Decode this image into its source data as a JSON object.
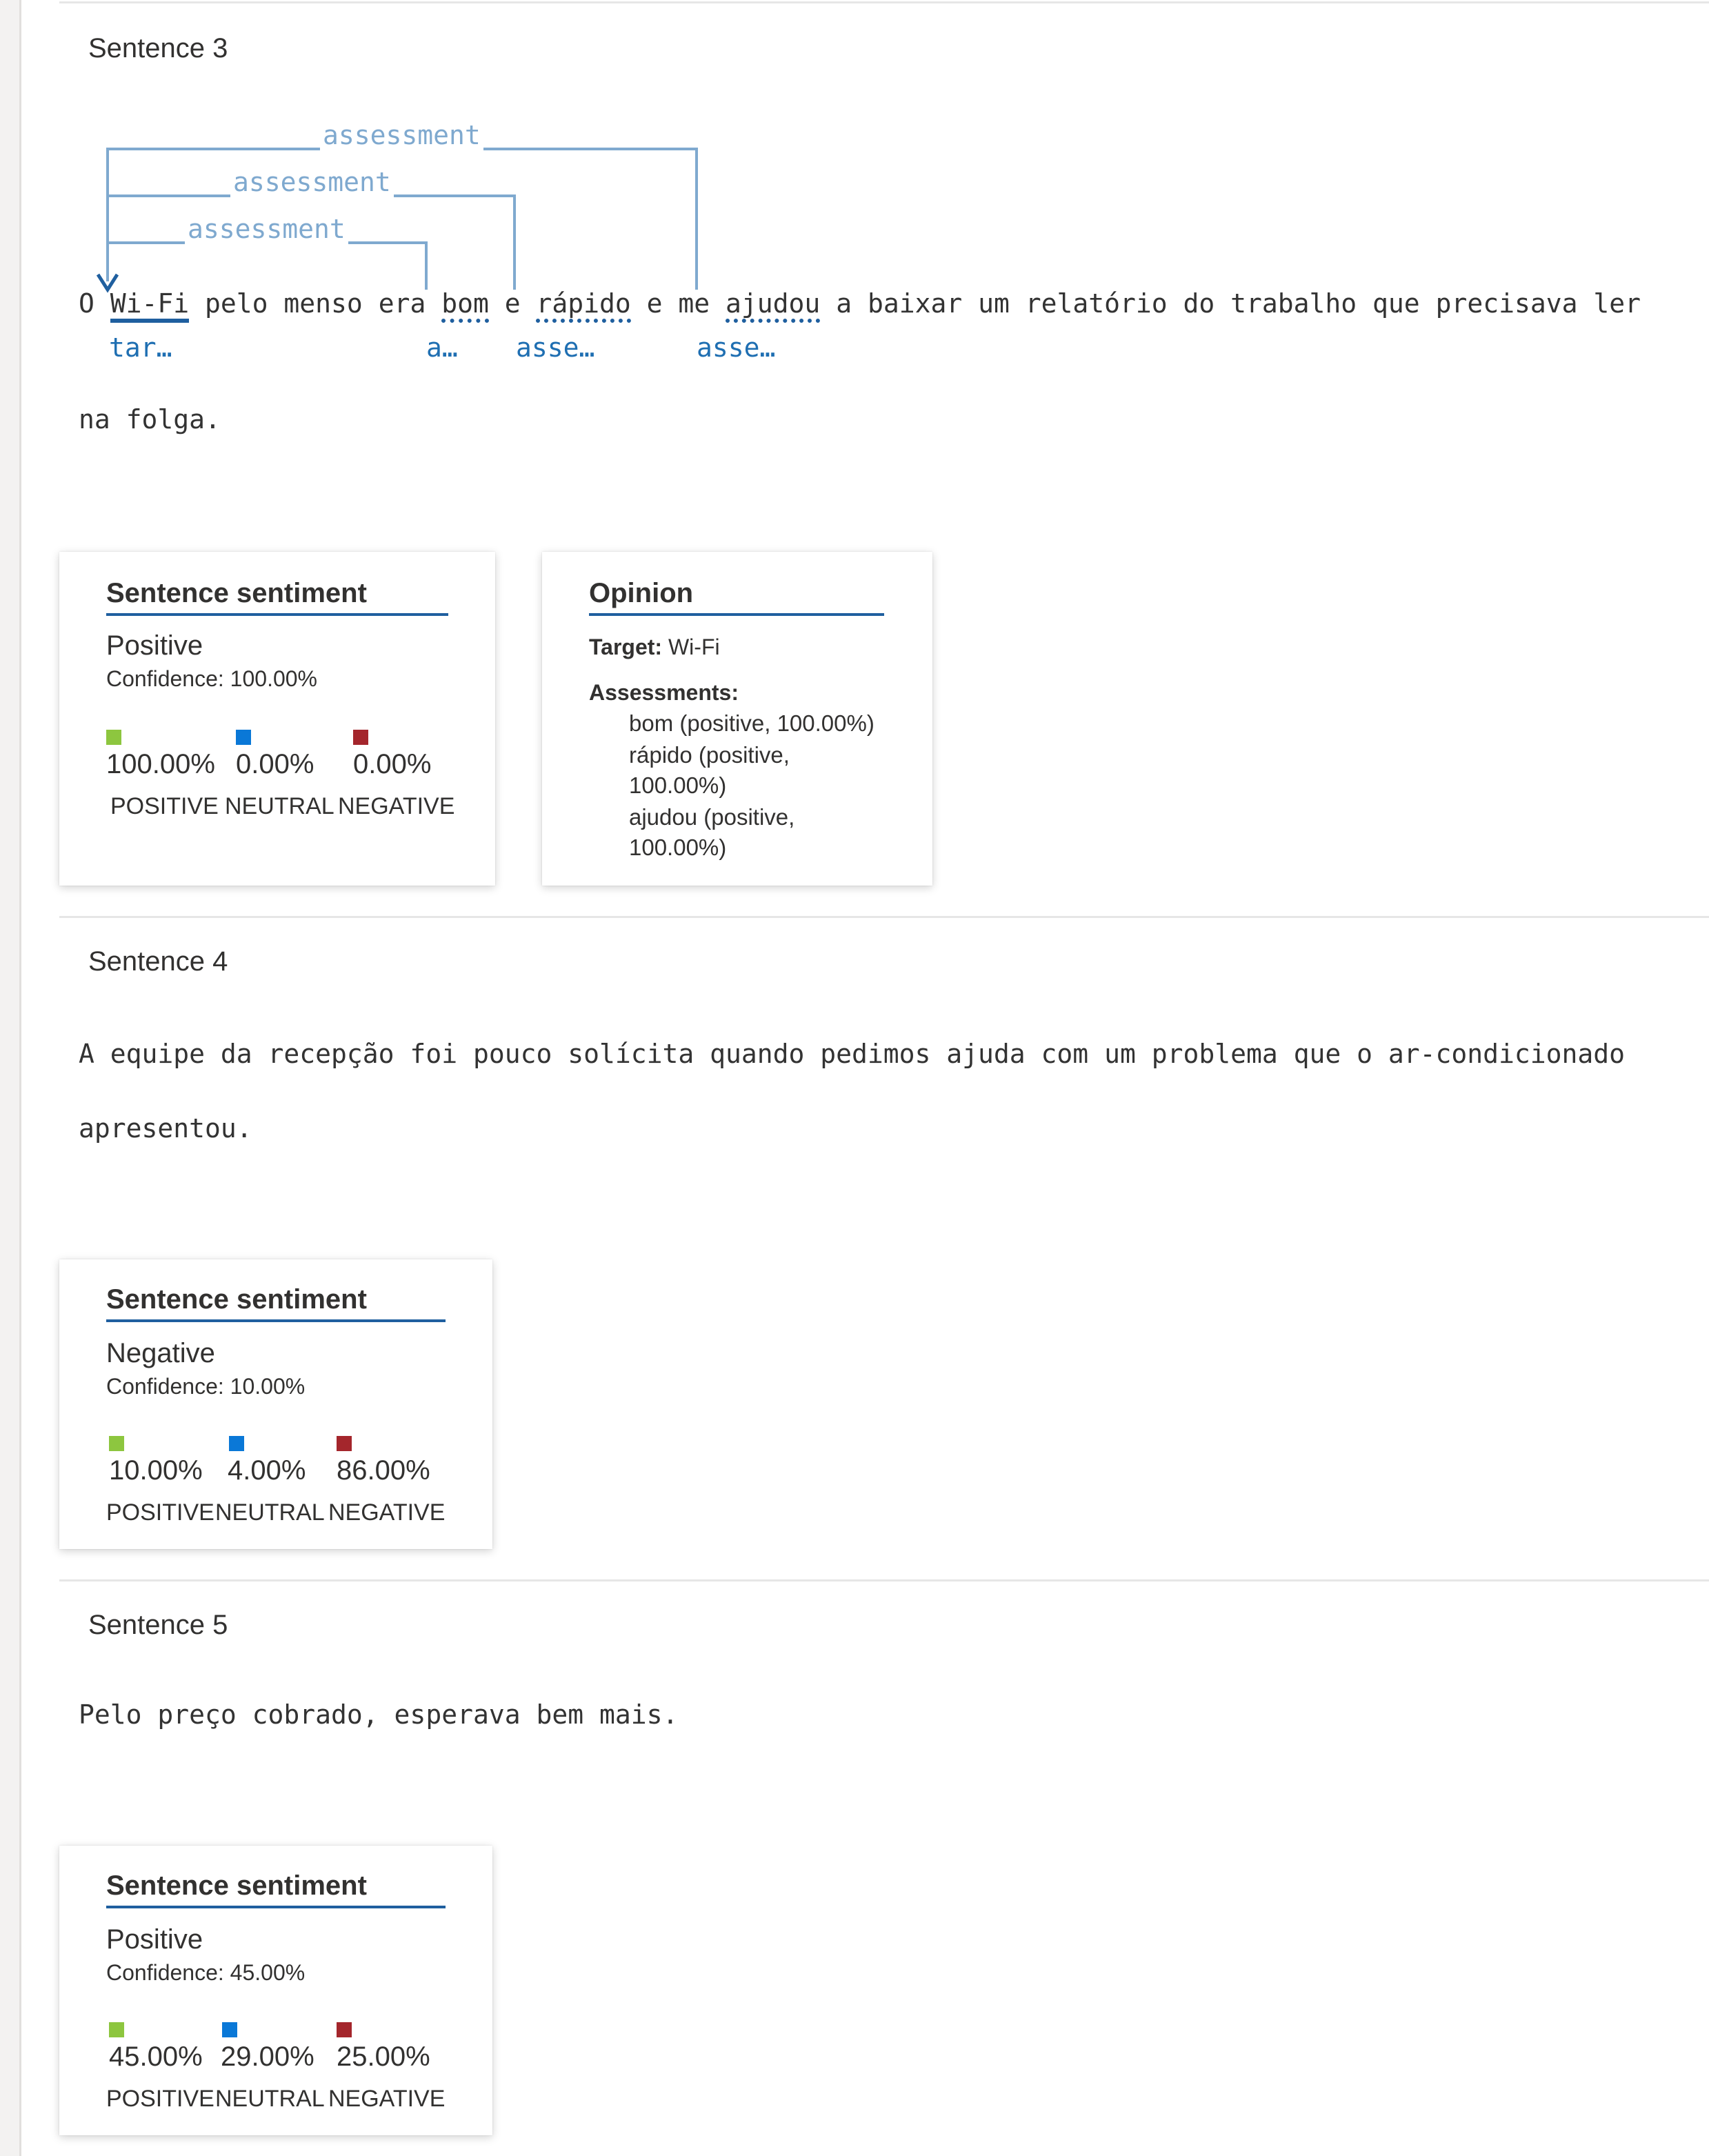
{
  "colors": {
    "positive": "#8dc63f",
    "neutral": "#0a78d7",
    "negative": "#a4262c",
    "accent": "#1f5f9f",
    "relation": "#7fa9cf"
  },
  "sentence3": {
    "title": "Sentence 3",
    "line1_tokens": [
      "O ",
      "Wi-Fi",
      " pelo menso era ",
      "bom",
      " e ",
      "rápido",
      " e me ",
      "ajudou",
      " a baixar um relatório do trabalho que precisava ler"
    ],
    "line2": "na folga.",
    "tags": {
      "wifi": "tar…",
      "bom": "a…",
      "rapido": "asse…",
      "ajudou": "asse…"
    },
    "relations": [
      "assessment",
      "assessment",
      "assessment"
    ],
    "sentiment_card": {
      "title": "Sentence sentiment",
      "label": "Positive",
      "confidence": "Confidence: 100.00%",
      "scores": [
        {
          "pct": "100.00%",
          "cat": "POSITIVE"
        },
        {
          "pct": "0.00%",
          "cat": "NEUTRAL"
        },
        {
          "pct": "0.00%",
          "cat": "NEGATIVE"
        }
      ]
    },
    "opinion_card": {
      "title": "Opinion",
      "target_label": "Target:",
      "target_value": " Wi-Fi",
      "assessments_label": "Assessments:",
      "assessment_lines": [
        "bom (positive, 100.00%)",
        "rápido (positive,",
        "100.00%)",
        "ajudou (positive,",
        "100.00%)"
      ]
    }
  },
  "sentence4": {
    "title": "Sentence 4",
    "line1": "A equipe da recepção foi pouco solícita quando pedimos ajuda com um problema que o ar-condicionado",
    "line2": "apresentou.",
    "sentiment_card": {
      "title": "Sentence sentiment",
      "label": "Negative",
      "confidence": "Confidence: 10.00%",
      "scores": [
        {
          "pct": "10.00%",
          "cat": "POSITIVE"
        },
        {
          "pct": "4.00%",
          "cat": "NEUTRAL"
        },
        {
          "pct": "86.00%",
          "cat": "NEGATIVE"
        }
      ]
    }
  },
  "sentence5": {
    "title": "Sentence 5",
    "line1": "Pelo preço cobrado, esperava bem mais.",
    "sentiment_card": {
      "title": "Sentence sentiment",
      "label": "Positive",
      "confidence": "Confidence: 45.00%",
      "scores": [
        {
          "pct": "45.00%",
          "cat": "POSITIVE"
        },
        {
          "pct": "29.00%",
          "cat": "NEUTRAL"
        },
        {
          "pct": "25.00%",
          "cat": "NEGATIVE"
        }
      ]
    }
  }
}
